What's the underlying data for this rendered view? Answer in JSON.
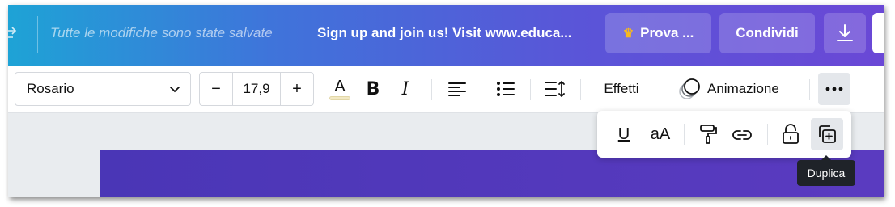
{
  "topbar": {
    "save_status": "Tutte le modifiche sono state salvate",
    "promo": "Sign up and join us! Visit www.educa...",
    "prova_label": "Prova ...",
    "condividi_label": "Condividi",
    "gradient_start": "#1ea3d6",
    "gradient_end": "#6a48d6"
  },
  "toolbar": {
    "font_name": "Rosario",
    "font_size": "17,9",
    "minus": "−",
    "plus": "+",
    "color_letter": "A",
    "bold_letter": "B",
    "italic_letter": "I",
    "effetti_label": "Effetti",
    "animazione_label": "Animazione"
  },
  "more_menu": {
    "underline_letter": "U",
    "case_label": "aA"
  },
  "tooltip": "Duplica",
  "colors": {
    "canvas_block": "#4a36b6",
    "tooltip_bg": "#1f2329",
    "crown": "#f5b820"
  },
  "icons": [
    "undo-icon",
    "crown-icon",
    "download-icon",
    "chevron-down-icon",
    "align-left-icon",
    "bullet-list-icon",
    "line-spacing-icon",
    "animation-icon",
    "more-dots-icon",
    "paint-roller-icon",
    "link-icon",
    "lock-open-icon",
    "duplicate-icon"
  ]
}
